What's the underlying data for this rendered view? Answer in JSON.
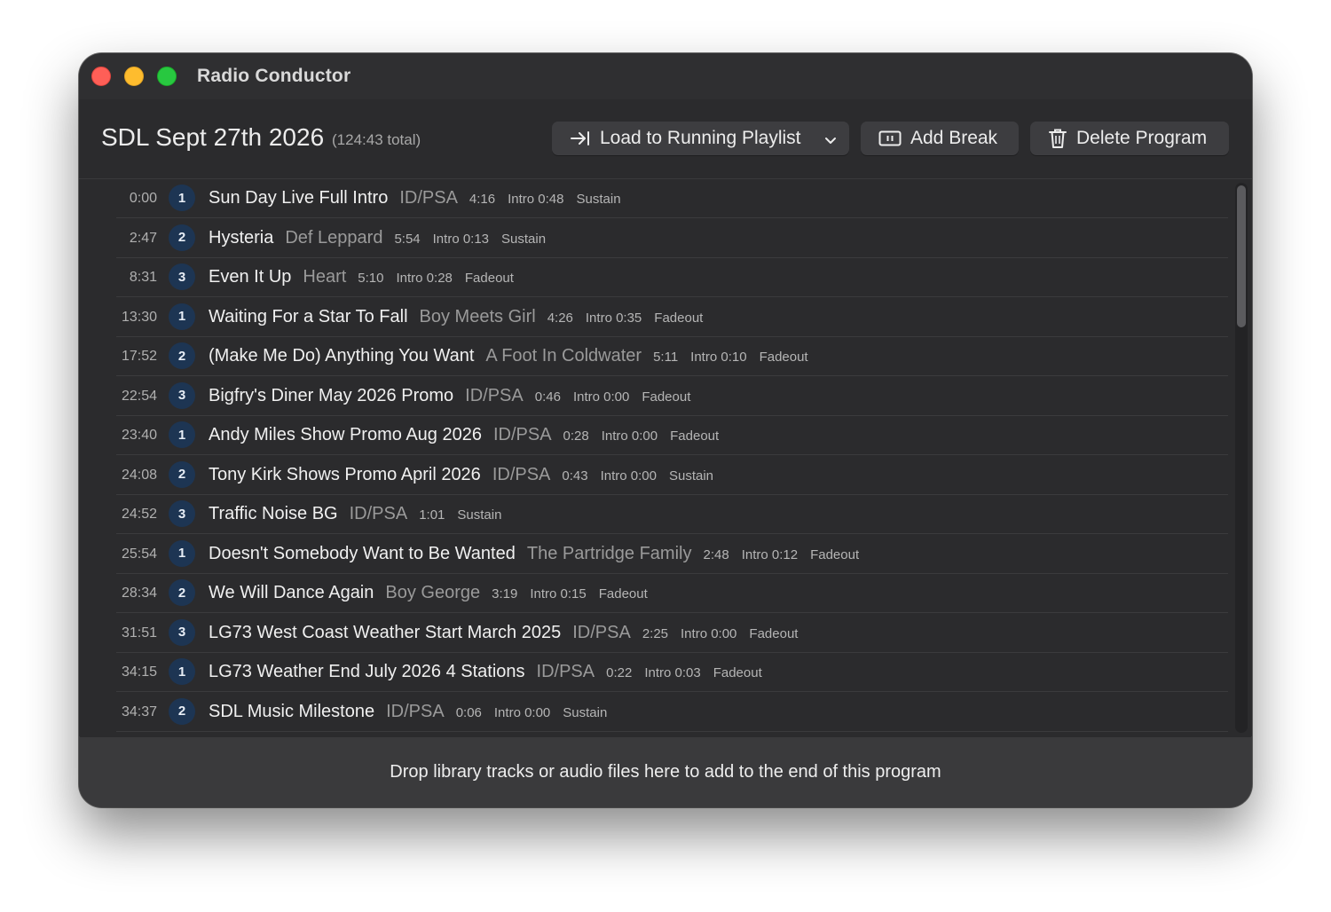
{
  "window": {
    "title": "Radio Conductor"
  },
  "program": {
    "title": "SDL Sept 27th 2026",
    "total": "(124:43 total)"
  },
  "toolbar": {
    "load_label": "Load to Running Playlist",
    "break_label": "Add Break",
    "delete_label": "Delete Program"
  },
  "tracks": [
    {
      "time": "0:00",
      "num": "1",
      "title": "Sun Day Live Full Intro",
      "artist": "ID/PSA",
      "length": "4:16",
      "intro": "Intro 0:48",
      "end": "Sustain"
    },
    {
      "time": "2:47",
      "num": "2",
      "title": "Hysteria",
      "artist": "Def Leppard",
      "length": "5:54",
      "intro": "Intro 0:13",
      "end": "Sustain"
    },
    {
      "time": "8:31",
      "num": "3",
      "title": "Even It Up",
      "artist": "Heart",
      "length": "5:10",
      "intro": "Intro 0:28",
      "end": "Fadeout"
    },
    {
      "time": "13:30",
      "num": "1",
      "title": "Waiting For a Star To Fall",
      "artist": "Boy Meets Girl",
      "length": "4:26",
      "intro": "Intro 0:35",
      "end": "Fadeout"
    },
    {
      "time": "17:52",
      "num": "2",
      "title": "(Make Me Do) Anything You Want",
      "artist": "A Foot In Coldwater",
      "length": "5:11",
      "intro": "Intro 0:10",
      "end": "Fadeout"
    },
    {
      "time": "22:54",
      "num": "3",
      "title": "Bigfry's Diner May 2026 Promo",
      "artist": "ID/PSA",
      "length": "0:46",
      "intro": "Intro 0:00",
      "end": "Fadeout"
    },
    {
      "time": "23:40",
      "num": "1",
      "title": "Andy Miles Show Promo Aug 2026",
      "artist": "ID/PSA",
      "length": "0:28",
      "intro": "Intro 0:00",
      "end": "Fadeout"
    },
    {
      "time": "24:08",
      "num": "2",
      "title": "Tony Kirk Shows Promo April 2026",
      "artist": "ID/PSA",
      "length": "0:43",
      "intro": "Intro 0:00",
      "end": "Sustain"
    },
    {
      "time": "24:52",
      "num": "3",
      "title": "Traffic Noise BG",
      "artist": "ID/PSA",
      "length": "1:01",
      "intro": "",
      "end": "Sustain"
    },
    {
      "time": "25:54",
      "num": "1",
      "title": "Doesn't Somebody Want to Be Wanted",
      "artist": "The Partridge Family",
      "length": "2:48",
      "intro": "Intro 0:12",
      "end": "Fadeout"
    },
    {
      "time": "28:34",
      "num": "2",
      "title": "We Will Dance Again",
      "artist": "Boy George",
      "length": "3:19",
      "intro": "Intro 0:15",
      "end": "Fadeout"
    },
    {
      "time": "31:51",
      "num": "3",
      "title": "LG73 West Coast Weather Start March 2025",
      "artist": "ID/PSA",
      "length": "2:25",
      "intro": "Intro 0:00",
      "end": "Fadeout"
    },
    {
      "time": "34:15",
      "num": "1",
      "title": "LG73 Weather End July 2026 4 Stations",
      "artist": "ID/PSA",
      "length": "0:22",
      "intro": "Intro 0:03",
      "end": "Fadeout"
    },
    {
      "time": "34:37",
      "num": "2",
      "title": "SDL Music Milestone",
      "artist": "ID/PSA",
      "length": "0:06",
      "intro": "Intro 0:00",
      "end": "Sustain"
    }
  ],
  "dropzone": {
    "text": "Drop library tracks or audio files here to add to the end of this program"
  },
  "icons": {
    "load": "arrow-to-line-icon",
    "break": "pause-rectangle-icon",
    "delete": "trash-icon",
    "chevron": "chevron-down-icon"
  },
  "colors": {
    "window_bg": "#2b2b2d",
    "badge_bg": "#1d3553",
    "close": "#fe5f57",
    "minimize": "#febc2e",
    "zoom": "#28c840"
  }
}
